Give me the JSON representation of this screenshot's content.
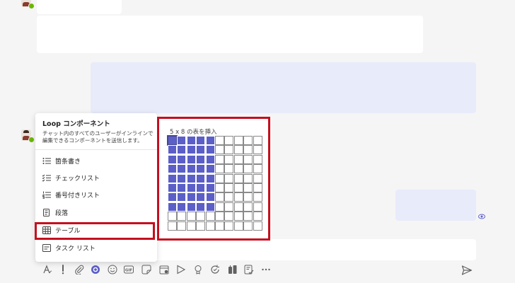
{
  "loop_menu": {
    "title": "Loop コンポーネント",
    "description": "チャット内のすべてのユーザーがインラインで編集できるコンポーネントを送信します。",
    "items": [
      {
        "label": "箇条書き",
        "icon": "bulleted-list-icon"
      },
      {
        "label": "チェックリスト",
        "icon": "checklist-icon"
      },
      {
        "label": "番号付きリスト",
        "icon": "numbered-list-icon"
      },
      {
        "label": "段落",
        "icon": "paragraph-icon"
      },
      {
        "label": "テーブル",
        "icon": "table-icon",
        "highlighted": true
      },
      {
        "label": "タスク リスト",
        "icon": "task-list-icon"
      }
    ]
  },
  "table_picker": {
    "title": "5 x 8 の表を挿入",
    "grid_columns": 10,
    "grid_rows": 10,
    "selected_columns": 5,
    "selected_rows": 8
  },
  "toolbar": {
    "icons": [
      "format-icon",
      "priority-icon",
      "attach-icon",
      "loop-icon",
      "emoji-icon",
      "gif-icon",
      "sticker-icon",
      "schedule-meeting-icon",
      "stream-icon",
      "praise-icon",
      "update-icon",
      "apps-icon",
      "approvals-icon",
      "more-icon"
    ]
  },
  "colors": {
    "accent": "#5b5fc7",
    "highlight": "#c50f1f",
    "bubble_self": "#e8ebfa"
  }
}
